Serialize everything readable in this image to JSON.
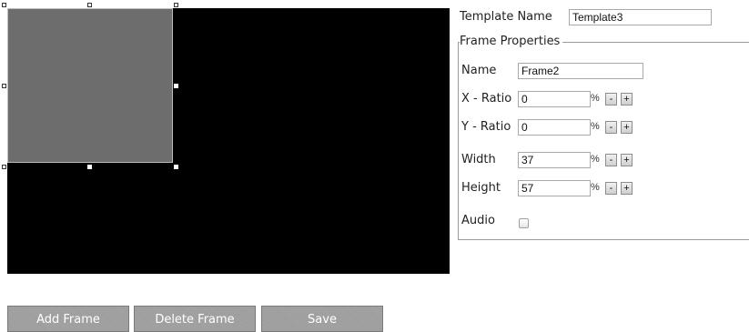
{
  "template": {
    "label": "Template Name",
    "value": "Template3"
  },
  "frame_properties": {
    "legend": "Frame Properties",
    "name_label": "Name",
    "name_value": "Frame2",
    "x_ratio_label": "X - Ratio",
    "x_ratio_value": "0",
    "y_ratio_label": "Y - Ratio",
    "y_ratio_value": "0",
    "width_label": "Width",
    "width_value": "37",
    "height_label": "Height",
    "height_value": "57",
    "audio_label": "Audio",
    "audio_checked": false,
    "percent_symbol": "%",
    "decrement_label": "-",
    "increment_label": "+"
  },
  "actions": {
    "add_frame": "Add Frame",
    "delete_frame": "Delete Frame",
    "save": "Save"
  },
  "colors": {
    "canvas_background": "#000000",
    "frame_fill": "#6d6d6d",
    "button_background": "#a0a0a0",
    "button_text": "#ffffff"
  }
}
